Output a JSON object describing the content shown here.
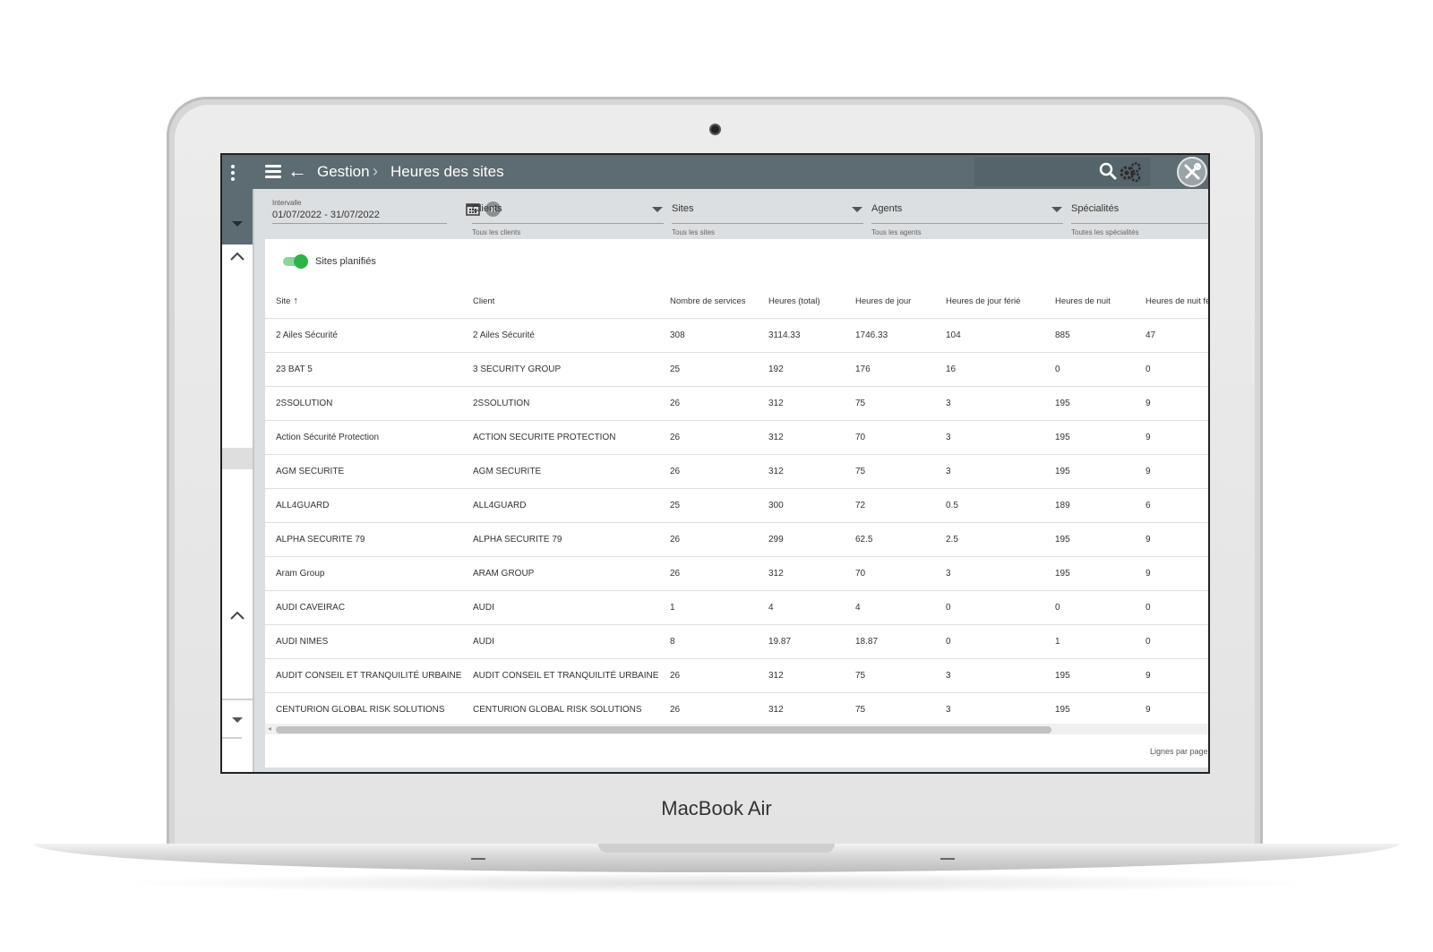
{
  "device": {
    "brand_label": "MacBook Air"
  },
  "header": {
    "crumb_parent": "Gestion",
    "crumb_current": "Heures des sites",
    "icons": [
      "more-vert-icon",
      "menu-icon",
      "back-arrow-icon",
      "search-icon",
      "gear-icon",
      "tools-icon"
    ]
  },
  "filters": {
    "interval": {
      "label": "Intervalle",
      "value": "01/07/2022 - 31/07/2022"
    },
    "clients": {
      "label": "Clients",
      "sub": "Tous les clients"
    },
    "sites": {
      "label": "Sites",
      "sub": "Tous les sites"
    },
    "agents": {
      "label": "Agents",
      "sub": "Tous les agents"
    },
    "specialites": {
      "label": "Spécialités",
      "sub": "Toutes les spécialités"
    }
  },
  "toggle": {
    "label": "Sites planifiés",
    "on": true,
    "color": "#2db34a"
  },
  "table": {
    "headers": [
      "Site",
      "Client",
      "Nombre de services",
      "Heures (total)",
      "Heures de jour",
      "Heures de jour férié",
      "Heures de nuit",
      "Heures de nuit fé"
    ],
    "rows": [
      [
        "2 Ailes Sécurité",
        "2 Ailes Sécurité",
        "308",
        "3114.33",
        "1746.33",
        "104",
        "885",
        "47"
      ],
      [
        "23 BAT 5",
        "3 SECURITY GROUP",
        "25",
        "192",
        "176",
        "16",
        "0",
        "0"
      ],
      [
        "2SSOLUTION",
        "2SSOLUTION",
        "26",
        "312",
        "75",
        "3",
        "195",
        "9"
      ],
      [
        "Action Sécurité Protection",
        "ACTION SECURITE PROTECTION",
        "26",
        "312",
        "70",
        "3",
        "195",
        "9"
      ],
      [
        "AGM SECURITE",
        "AGM SECURITE",
        "26",
        "312",
        "75",
        "3",
        "195",
        "9"
      ],
      [
        "ALL4GUARD",
        "ALL4GUARD",
        "25",
        "300",
        "72",
        "0.5",
        "189",
        "6"
      ],
      [
        "ALPHA SECURITE 79",
        "ALPHA SECURITE 79",
        "26",
        "299",
        "62.5",
        "2.5",
        "195",
        "9"
      ],
      [
        "Aram Group",
        "ARAM GROUP",
        "26",
        "312",
        "70",
        "3",
        "195",
        "9"
      ],
      [
        "AUDI CAVEIRAC",
        "AUDI",
        "1",
        "4",
        "4",
        "0",
        "0",
        "0"
      ],
      [
        "AUDI NIMES",
        "AUDI",
        "8",
        "19.87",
        "18.87",
        "0",
        "1",
        "0"
      ],
      [
        "AUDIT CONSEIL ET TRANQUILITÉ URBAINE",
        "AUDIT CONSEIL ET TRANQUILITÉ URBAINE",
        "26",
        "312",
        "75",
        "3",
        "195",
        "9"
      ],
      [
        "CENTURION GLOBAL RISK SOLUTIONS",
        "CENTURION GLOBAL RISK SOLUTIONS",
        "26",
        "312",
        "75",
        "3",
        "195",
        "9"
      ]
    ]
  },
  "footer": {
    "rows_per_page_label": "Lignes par page"
  },
  "colors": {
    "header_bg": "#5d6b72",
    "toggle_on": "#2db34a"
  }
}
